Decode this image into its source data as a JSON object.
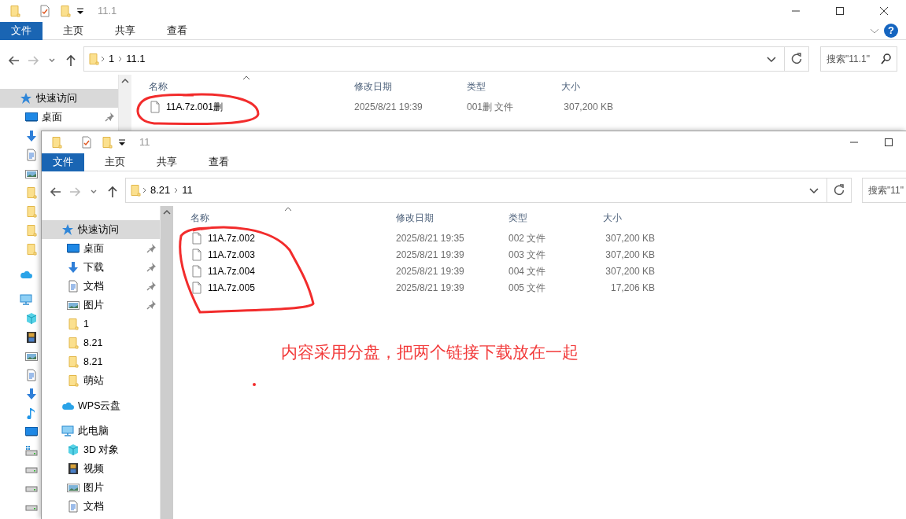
{
  "windows": [
    {
      "title": "11.1",
      "buttons": {
        "minimize": true,
        "maximize": true,
        "close": true
      },
      "help": "?",
      "tabs": [
        {
          "label": "文件",
          "selected": true
        },
        {
          "label": "主页",
          "selected": false
        },
        {
          "label": "共享",
          "selected": false
        },
        {
          "label": "查看",
          "selected": false
        }
      ],
      "path": [
        "1",
        "11.1"
      ],
      "search": {
        "placeholder": "搜索\"11.1\""
      },
      "sidebar": [
        {
          "kind": "quick-access",
          "label": "快速访问",
          "selected": true,
          "children": [
            {
              "kind": "desktop",
              "label": "桌面",
              "selected": false,
              "pinned": true
            },
            {
              "kind": "download",
              "selected": false,
              "pinned": false
            },
            {
              "kind": "document",
              "selected": false,
              "pinned": false
            },
            {
              "kind": "picture",
              "selected": false,
              "pinned": false
            },
            {
              "kind": "folder",
              "selected": false,
              "pinned": false
            },
            {
              "kind": "folder",
              "selected": false,
              "pinned": false
            },
            {
              "kind": "folder",
              "selected": false,
              "pinned": false
            },
            {
              "kind": "folder",
              "selected": false,
              "pinned": false
            }
          ]
        },
        {
          "kind": "cloud",
          "selected": false
        },
        {
          "kind": "pc",
          "selected": false,
          "children": [
            {
              "kind": "cube",
              "selected": false
            },
            {
              "kind": "video",
              "selected": false
            },
            {
              "kind": "picture",
              "selected": false
            },
            {
              "kind": "document",
              "selected": false
            },
            {
              "kind": "download",
              "selected": false
            },
            {
              "kind": "music",
              "selected": false
            },
            {
              "kind": "desktop",
              "selected": false
            },
            {
              "kind": "system-drive",
              "selected": false
            },
            {
              "kind": "drive",
              "selected": false
            },
            {
              "kind": "drive",
              "selected": false
            },
            {
              "kind": "drive",
              "selected": false
            }
          ]
        }
      ],
      "columns": [
        "名称",
        "修改日期",
        "类型",
        "大小"
      ],
      "files": [
        {
          "name": "11A.7z.001删",
          "date": "2025/8/21 19:39",
          "type": "001删 文件",
          "size": "307,200 KB"
        }
      ]
    },
    {
      "title": "11",
      "buttons": {
        "minimize": true,
        "maximize": true,
        "close": false
      },
      "tabs": [
        {
          "label": "文件",
          "selected": true
        },
        {
          "label": "主页",
          "selected": false
        },
        {
          "label": "共享",
          "selected": false
        },
        {
          "label": "查看",
          "selected": false
        }
      ],
      "path": [
        "8.21",
        "11"
      ],
      "search": {
        "placeholder": "搜索\"11\""
      },
      "sidebar": [
        {
          "kind": "quick-access",
          "label": "快速访问",
          "selected": true,
          "children": [
            {
              "kind": "desktop",
              "label": "桌面",
              "selected": false,
              "pinned": true
            },
            {
              "kind": "download",
              "label": "下载",
              "selected": false,
              "pinned": true
            },
            {
              "kind": "document",
              "label": "文档",
              "selected": false,
              "pinned": true
            },
            {
              "kind": "picture",
              "label": "图片",
              "selected": false,
              "pinned": true
            },
            {
              "kind": "folder",
              "label": "1",
              "selected": false,
              "pinned": false
            },
            {
              "kind": "folder",
              "label": "8.21",
              "selected": false,
              "pinned": false
            },
            {
              "kind": "folder",
              "label": "8.21",
              "selected": false,
              "pinned": false
            },
            {
              "kind": "folder",
              "label": "萌站",
              "selected": false,
              "pinned": false
            }
          ]
        },
        {
          "kind": "cloud",
          "label": "WPS云盘",
          "selected": false
        },
        {
          "kind": "pc",
          "label": "此电脑",
          "selected": false,
          "children": [
            {
              "kind": "cube",
              "label": "3D 对象",
              "selected": false
            },
            {
              "kind": "video",
              "label": "视频",
              "selected": false
            },
            {
              "kind": "picture",
              "label": "图片",
              "selected": false
            },
            {
              "kind": "document",
              "label": "文档",
              "selected": false
            }
          ]
        }
      ],
      "columns": [
        "名称",
        "修改日期",
        "类型",
        "大小"
      ],
      "files": [
        {
          "name": "11A.7z.002",
          "date": "2025/8/21 19:35",
          "type": "002 文件",
          "size": "307,200 KB"
        },
        {
          "name": "11A.7z.003",
          "date": "2025/8/21 19:39",
          "type": "003 文件",
          "size": "307,200 KB"
        },
        {
          "name": "11A.7z.004",
          "date": "2025/8/21 19:39",
          "type": "004 文件",
          "size": "307,200 KB"
        },
        {
          "name": "11A.7z.005",
          "date": "2025/8/21 19:39",
          "type": "005 文件",
          "size": "17,206 KB"
        }
      ]
    }
  ],
  "note": "内容采用分盘，把两个链接下载放在一起"
}
